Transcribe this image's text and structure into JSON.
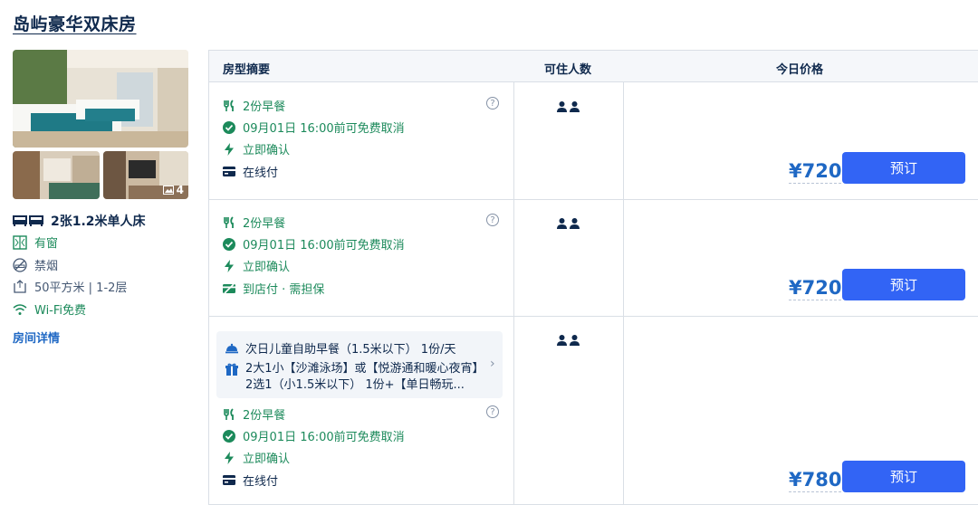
{
  "room": {
    "title": "岛屿豪华双床房",
    "photo_count": "4",
    "bed": "2张1.2米单人床",
    "features": [
      {
        "icon": "window-icon",
        "label": "有窗",
        "green": true
      },
      {
        "icon": "no-smoking-icon",
        "label": "禁烟",
        "green": false
      },
      {
        "icon": "area-icon",
        "label": "50平方米 | 1-2层",
        "green": false
      },
      {
        "icon": "wifi-icon",
        "label": "Wi-Fi免费",
        "green": true
      }
    ],
    "detail_link": "房间详情"
  },
  "table": {
    "headers": {
      "summary": "房型摘要",
      "guests": "可住人数",
      "price": "今日价格"
    },
    "help_mark": "?",
    "book_label": "预订",
    "offers": [
      {
        "items": [
          {
            "icon": "meal-icon",
            "text": "2份早餐"
          },
          {
            "icon": "check-circle-icon",
            "text": "09月01日 16:00前可免费取消"
          },
          {
            "icon": "lightning-icon",
            "text": "立即确认"
          },
          {
            "icon": "card-icon",
            "text": "在线付"
          }
        ],
        "price": "¥720"
      },
      {
        "items": [
          {
            "icon": "meal-icon",
            "text": "2份早餐"
          },
          {
            "icon": "check-circle-icon",
            "text": "09月01日 16:00前可免费取消"
          },
          {
            "icon": "lightning-icon",
            "text": "立即确认"
          },
          {
            "icon": "pay-at-hotel-icon",
            "text": "到店付 · 需担保"
          }
        ],
        "price": "¥720"
      },
      {
        "package": {
          "line1": "次日儿童自助早餐（1.5米以下） 1份/天",
          "line2": "2大1小【沙滩泳场】或【悦游通和暖心夜宵】2选1（小1.5米以下） 1份+【单日畅玩..."
        },
        "items": [
          {
            "icon": "meal-icon",
            "text": "2份早餐"
          },
          {
            "icon": "check-circle-icon",
            "text": "09月01日 16:00前可免费取消"
          },
          {
            "icon": "lightning-icon",
            "text": "立即确认"
          },
          {
            "icon": "card-icon",
            "text": "在线付"
          }
        ],
        "price": "¥780"
      }
    ]
  },
  "colors": {
    "accent_blue": "#3264f5",
    "price_blue": "#1f68c4",
    "green": "#1c8a5b",
    "text_dark": "#0f294d"
  }
}
